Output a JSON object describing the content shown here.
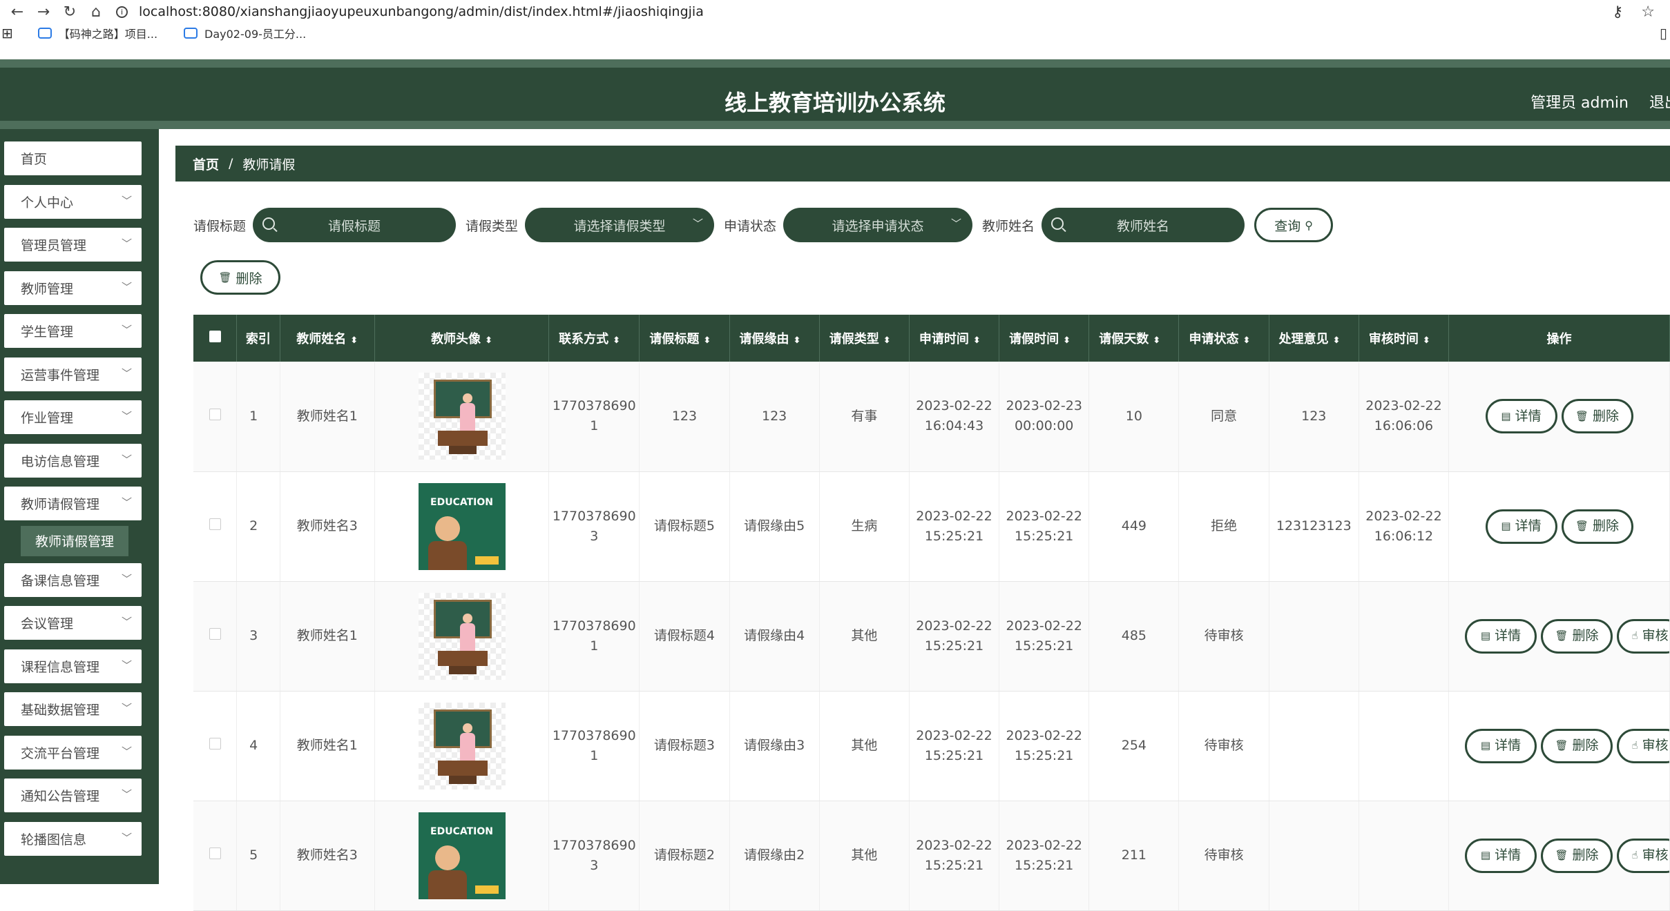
{
  "browser": {
    "url": "localhost:8080/xianshangjiaoyupeuxunbangong/admin/dist/index.html#/jiaoshiqingjia",
    "bookmarks": [
      "【码神之路】项目...",
      "Day02-09-员工分..."
    ]
  },
  "header": {
    "title": "线上教育培训办公系统",
    "user": "管理员 admin",
    "logout": "退出"
  },
  "sidebar": {
    "items": [
      {
        "label": "首页",
        "has_arrow": false
      },
      {
        "label": "个人中心"
      },
      {
        "label": "管理员管理"
      },
      {
        "label": "教师管理"
      },
      {
        "label": "学生管理"
      },
      {
        "label": "运营事件管理"
      },
      {
        "label": "作业管理"
      },
      {
        "label": "电访信息管理"
      },
      {
        "label": "教师请假管理"
      },
      {
        "label": "备课信息管理"
      },
      {
        "label": "会议管理"
      },
      {
        "label": "课程信息管理"
      },
      {
        "label": "基础数据管理"
      },
      {
        "label": "交流平台管理"
      },
      {
        "label": "通知公告管理"
      },
      {
        "label": "轮播图信息"
      }
    ],
    "submenu": "教师请假管理"
  },
  "breadcrumb": {
    "home": "首页",
    "sep": "/",
    "current": "教师请假"
  },
  "filters": {
    "title_label": "请假标题",
    "title_placeholder": "请假标题",
    "type_label": "请假类型",
    "type_placeholder": "请选择请假类型",
    "status_label": "申请状态",
    "status_placeholder": "请选择申请状态",
    "name_label": "教师姓名",
    "name_placeholder": "教师姓名",
    "query": "查询"
  },
  "bulk_delete": "删除",
  "table": {
    "headers": [
      "索引",
      "教师姓名",
      "教师头像",
      "联系方式",
      "请假标题",
      "请假缘由",
      "请假类型",
      "申请时间",
      "请假时间",
      "请假天数",
      "申请状态",
      "处理意见",
      "审核时间",
      "操作"
    ],
    "rows": [
      {
        "idx": "1",
        "name": "教师姓名1",
        "avatar": "teacher-a",
        "phone1": "1770378690",
        "phone2": "1",
        "title": "123",
        "reason": "123",
        "type": "有事",
        "apply1": "2023-02-22",
        "apply2": "16:04:43",
        "leave1": "2023-02-23",
        "leave2": "00:00:00",
        "days": "10",
        "status": "同意",
        "opinion": "123",
        "audit1": "2023-02-22",
        "audit2": "16:06:06",
        "audit_btn": false
      },
      {
        "idx": "2",
        "name": "教师姓名3",
        "avatar": "teacher-b",
        "phone1": "1770378690",
        "phone2": "3",
        "title": "请假标题5",
        "reason": "请假缘由5",
        "type": "生病",
        "apply1": "2023-02-22",
        "apply2": "15:25:21",
        "leave1": "2023-02-22",
        "leave2": "15:25:21",
        "days": "449",
        "status": "拒绝",
        "opinion": "123123123",
        "audit1": "2023-02-22",
        "audit2": "16:06:12",
        "audit_btn": false
      },
      {
        "idx": "3",
        "name": "教师姓名1",
        "avatar": "teacher-a",
        "phone1": "1770378690",
        "phone2": "1",
        "title": "请假标题4",
        "reason": "请假缘由4",
        "type": "其他",
        "apply1": "2023-02-22",
        "apply2": "15:25:21",
        "leave1": "2023-02-22",
        "leave2": "15:25:21",
        "days": "485",
        "status": "待审核",
        "opinion": "",
        "audit1": "",
        "audit2": "",
        "audit_btn": true
      },
      {
        "idx": "4",
        "name": "教师姓名1",
        "avatar": "teacher-a",
        "phone1": "1770378690",
        "phone2": "1",
        "title": "请假标题3",
        "reason": "请假缘由3",
        "type": "其他",
        "apply1": "2023-02-22",
        "apply2": "15:25:21",
        "leave1": "2023-02-22",
        "leave2": "15:25:21",
        "days": "254",
        "status": "待审核",
        "opinion": "",
        "audit1": "",
        "audit2": "",
        "audit_btn": true
      },
      {
        "idx": "5",
        "name": "教师姓名3",
        "avatar": "teacher-b",
        "phone1": "1770378690",
        "phone2": "3",
        "title": "请假标题2",
        "reason": "请假缘由2",
        "type": "其他",
        "apply1": "2023-02-22",
        "apply2": "15:25:21",
        "leave1": "2023-02-22",
        "leave2": "15:25:21",
        "days": "211",
        "status": "待审核",
        "opinion": "",
        "audit1": "",
        "audit2": "",
        "audit_btn": true
      }
    ],
    "actions": {
      "detail": "详情",
      "delete": "删除",
      "audit": "审核"
    },
    "avatar_text": {
      "teacher-b": "EDUCATION"
    }
  }
}
